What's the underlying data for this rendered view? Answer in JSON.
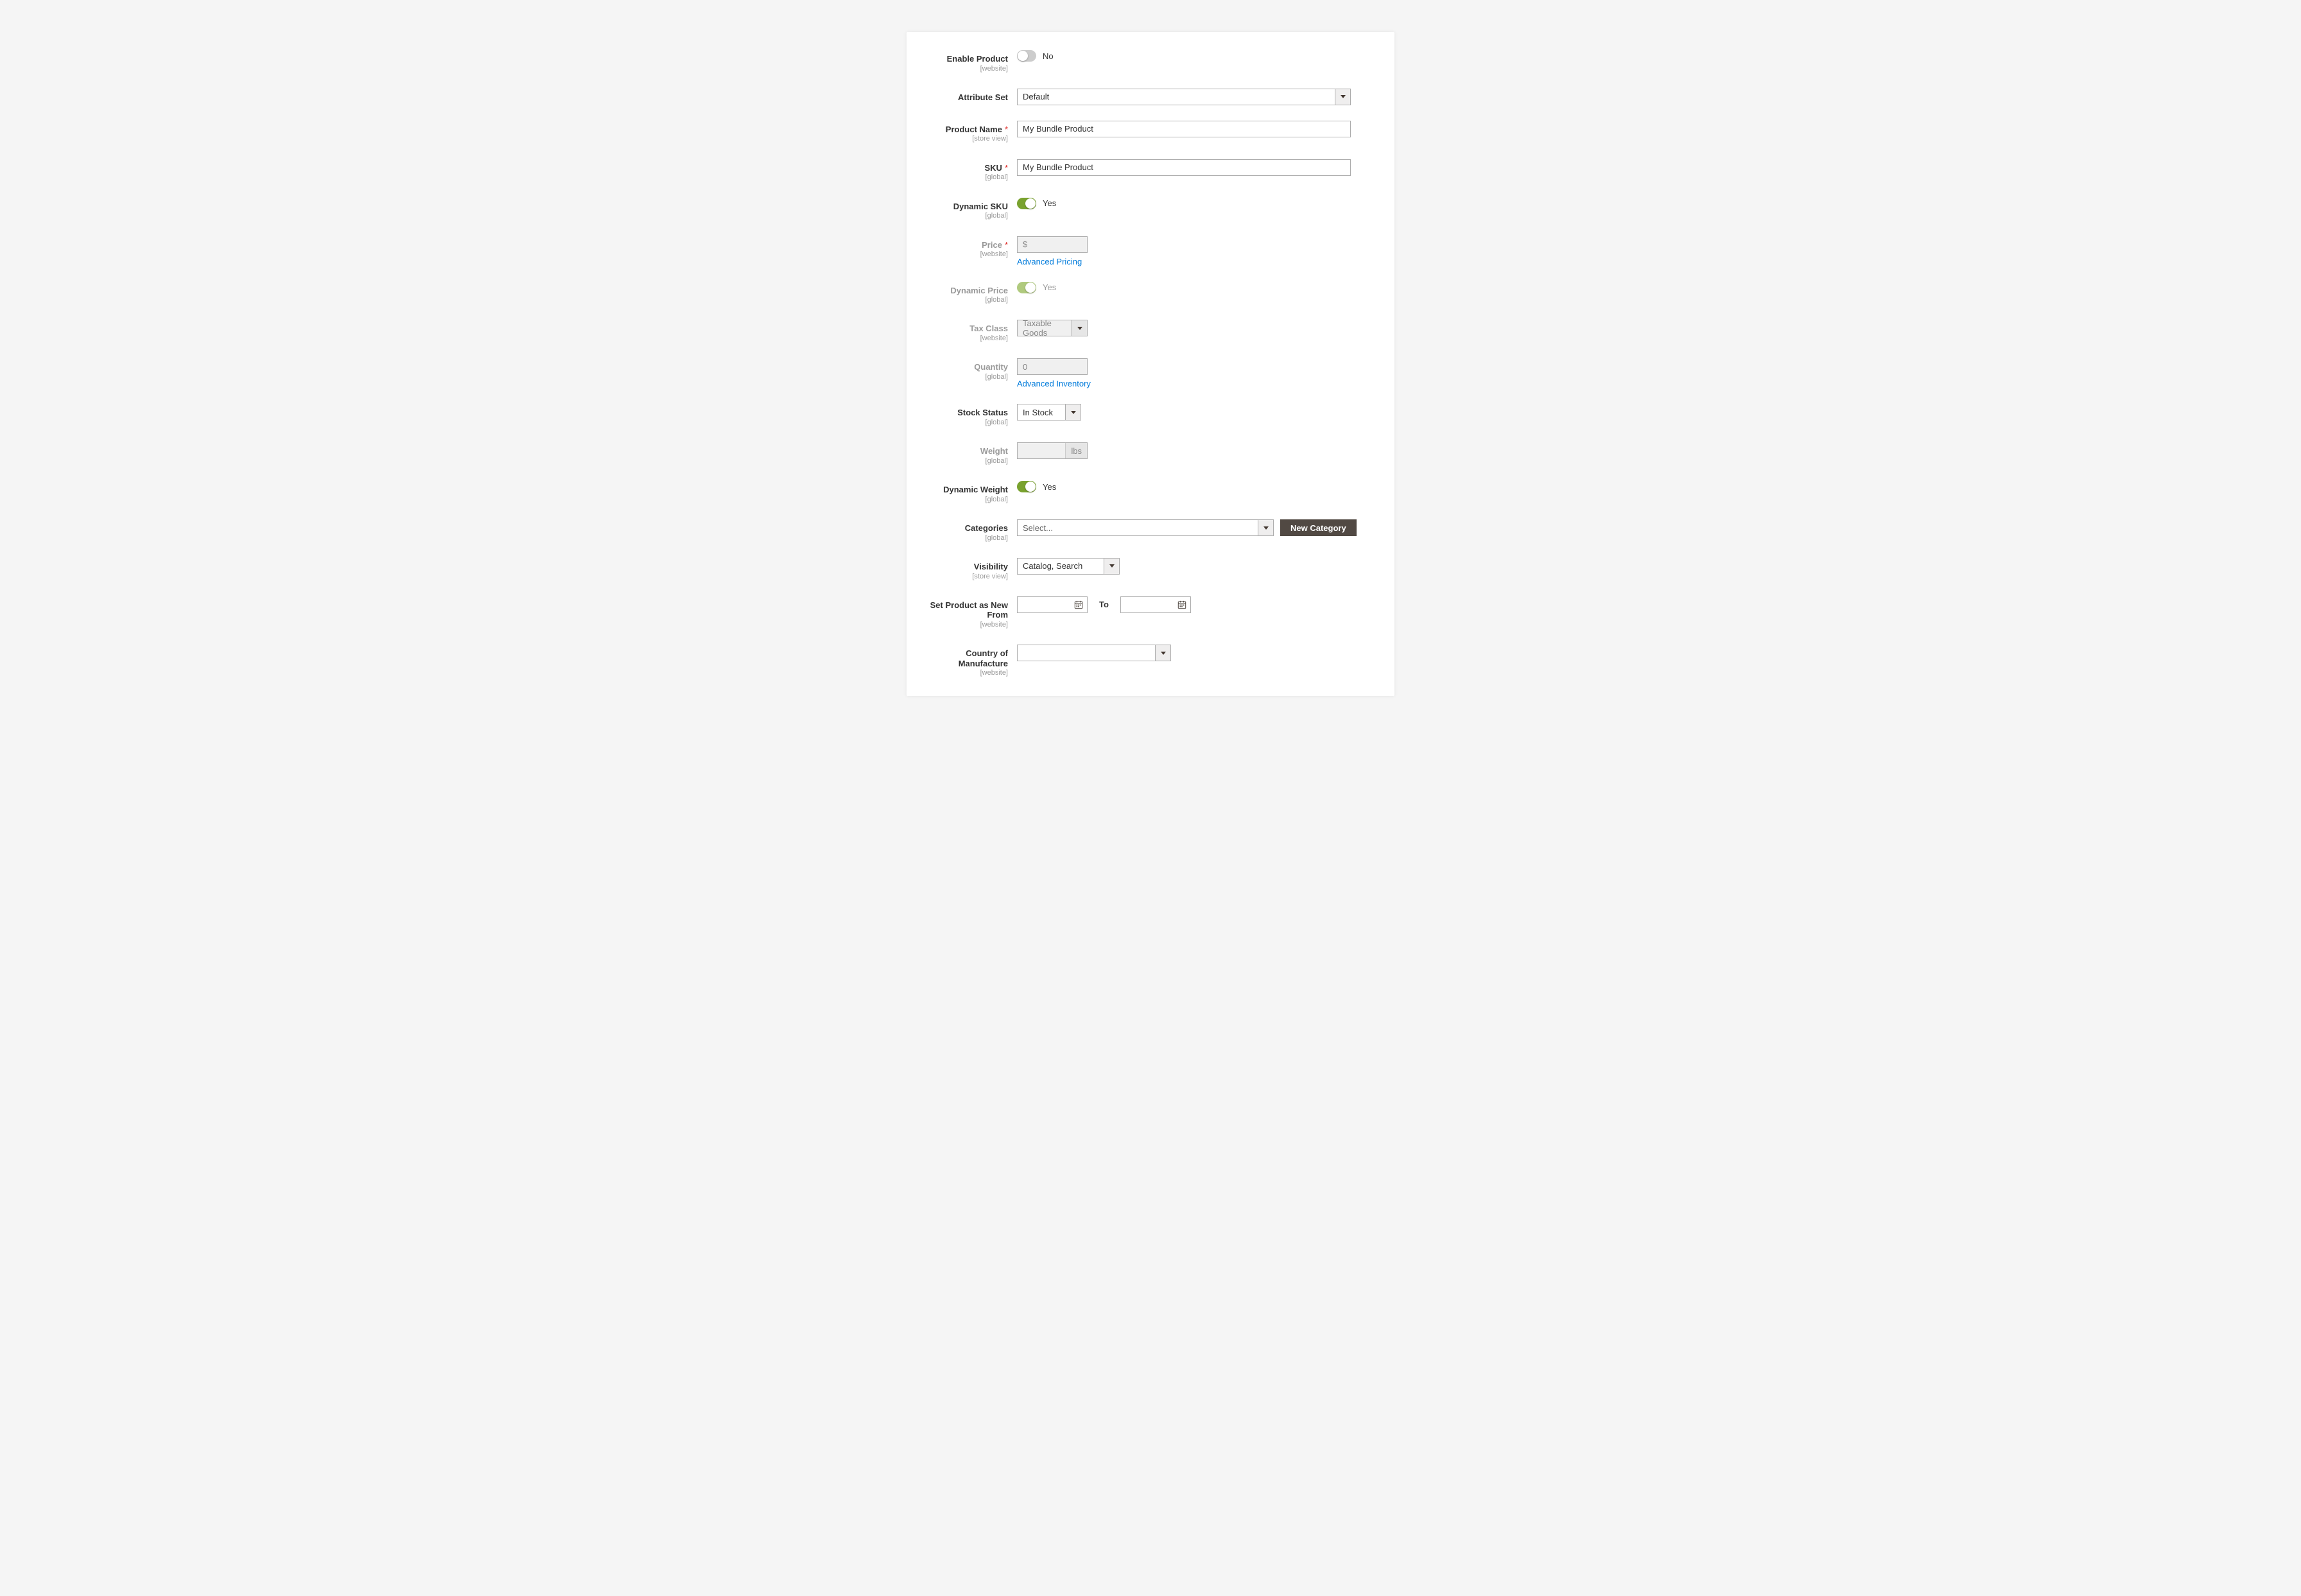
{
  "fields": {
    "enable_product": {
      "label": "Enable Product",
      "scope": "[website]",
      "value": "No"
    },
    "attribute_set": {
      "label": "Attribute Set",
      "value": "Default"
    },
    "product_name": {
      "label": "Product Name",
      "scope": "[store view]",
      "value": "My Bundle Product"
    },
    "sku": {
      "label": "SKU",
      "scope": "[global]",
      "value": "My Bundle Product"
    },
    "dynamic_sku": {
      "label": "Dynamic SKU",
      "scope": "[global]",
      "value": "Yes"
    },
    "price": {
      "label": "Price",
      "scope": "[website]",
      "currency": "$",
      "link": "Advanced Pricing"
    },
    "dynamic_price": {
      "label": "Dynamic Price",
      "scope": "[global]",
      "value": "Yes"
    },
    "tax_class": {
      "label": "Tax Class",
      "scope": "[website]",
      "value": "Taxable Goods"
    },
    "quantity": {
      "label": "Quantity",
      "scope": "[global]",
      "value": "0",
      "link": "Advanced Inventory"
    },
    "stock_status": {
      "label": "Stock Status",
      "scope": "[global]",
      "value": "In Stock"
    },
    "weight": {
      "label": "Weight",
      "scope": "[global]",
      "unit": "lbs"
    },
    "dynamic_weight": {
      "label": "Dynamic Weight",
      "scope": "[global]",
      "value": "Yes"
    },
    "categories": {
      "label": "Categories",
      "scope": "[global]",
      "value": "Select...",
      "button": "New Category"
    },
    "visibility": {
      "label": "Visibility",
      "scope": "[store view]",
      "value": "Catalog, Search"
    },
    "new_from": {
      "label": "Set Product as New From",
      "scope": "[website]",
      "to_label": "To"
    },
    "country": {
      "label": "Country of Manufacture",
      "scope": "[website]",
      "value": ""
    }
  }
}
